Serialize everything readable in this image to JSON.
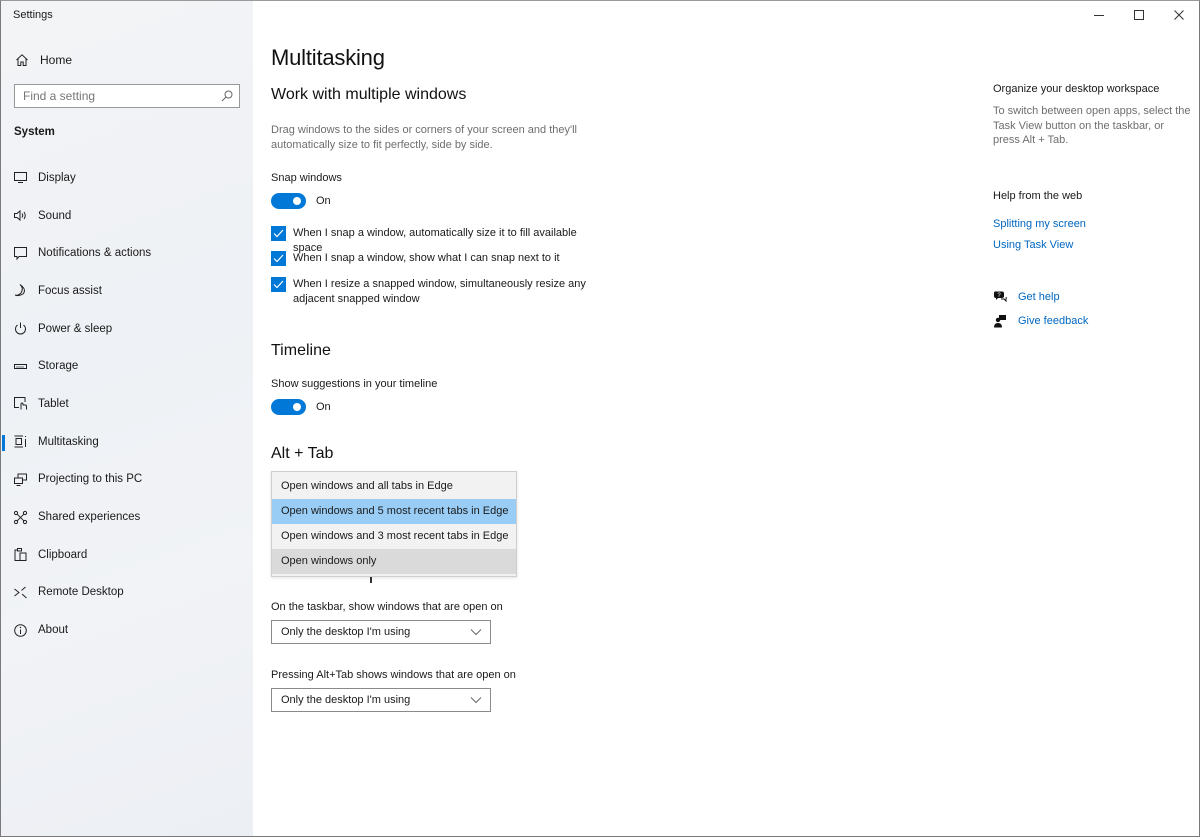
{
  "window": {
    "title": "Settings",
    "controls": {
      "minimize": "minimize-icon",
      "maximize": "maximize-icon",
      "close": "close-icon"
    }
  },
  "sidebar": {
    "home": {
      "label": "Home",
      "icon": "home-icon"
    },
    "search": {
      "placeholder": "Find a setting",
      "value": "",
      "icon": "search-icon"
    },
    "section_title": "System",
    "items": [
      {
        "label": "Display",
        "icon": "display-icon",
        "active": false
      },
      {
        "label": "Sound",
        "icon": "sound-icon",
        "active": false
      },
      {
        "label": "Notifications & actions",
        "icon": "notifications-icon",
        "active": false
      },
      {
        "label": "Focus assist",
        "icon": "moon-icon",
        "active": false
      },
      {
        "label": "Power & sleep",
        "icon": "power-icon",
        "active": false
      },
      {
        "label": "Storage",
        "icon": "storage-icon",
        "active": false
      },
      {
        "label": "Tablet",
        "icon": "tablet-icon",
        "active": false
      },
      {
        "label": "Multitasking",
        "icon": "multitasking-icon",
        "active": true
      },
      {
        "label": "Projecting to this PC",
        "icon": "projecting-icon",
        "active": false
      },
      {
        "label": "Shared experiences",
        "icon": "shared-experiences-icon",
        "active": false
      },
      {
        "label": "Clipboard",
        "icon": "clipboard-icon",
        "active": false
      },
      {
        "label": "Remote Desktop",
        "icon": "remote-desktop-icon",
        "active": false
      },
      {
        "label": "About",
        "icon": "info-icon",
        "active": false
      }
    ]
  },
  "main": {
    "page_title": "Multitasking",
    "snap": {
      "heading": "Work with multiple windows",
      "description": "Drag windows to the sides or corners of your screen and they'll automatically size to fit perfectly, side by side.",
      "toggle_label": "Snap windows",
      "toggle_state": "On",
      "toggle_on": true,
      "options": [
        {
          "label": "When I snap a window, automatically size it to fill available space",
          "checked": true
        },
        {
          "label": "When I snap a window, show what I can snap next to it",
          "checked": true
        },
        {
          "label": "When I resize a snapped window, simultaneously resize any adjacent snapped window",
          "checked": true
        }
      ]
    },
    "timeline": {
      "heading": "Timeline",
      "toggle_label": "Show suggestions in your timeline",
      "toggle_state": "On",
      "toggle_on": true
    },
    "alt_tab": {
      "heading": "Alt + Tab",
      "dropdown_open": true,
      "options": [
        {
          "label": "Open windows and all tabs in Edge",
          "state": "normal"
        },
        {
          "label": "Open windows and 5 most recent tabs in Edge",
          "state": "selected"
        },
        {
          "label": "Open windows and 3 most recent tabs in Edge",
          "state": "normal"
        },
        {
          "label": "Open windows only",
          "state": "hover"
        }
      ]
    },
    "virtual_desktops": {
      "taskbar_label": "On the taskbar, show windows that are open on",
      "taskbar_value": "Only the desktop I'm using",
      "alttab_label": "Pressing Alt+Tab shows windows that are open on",
      "alttab_value": "Only the desktop I'm using"
    }
  },
  "right_panel": {
    "organize_heading": "Organize your desktop workspace",
    "organize_text": "To switch between open apps, select the Task View button on the taskbar, or press Alt + Tab.",
    "help_heading": "Help from the web",
    "links": [
      "Splitting my screen",
      "Using Task View"
    ],
    "get_help": "Get help",
    "give_feedback": "Give feedback"
  },
  "colors": {
    "accent": "#0078d7",
    "link": "#0067c0",
    "dropdown_selected": "#99cdf6",
    "dropdown_hover": "#dadada"
  }
}
